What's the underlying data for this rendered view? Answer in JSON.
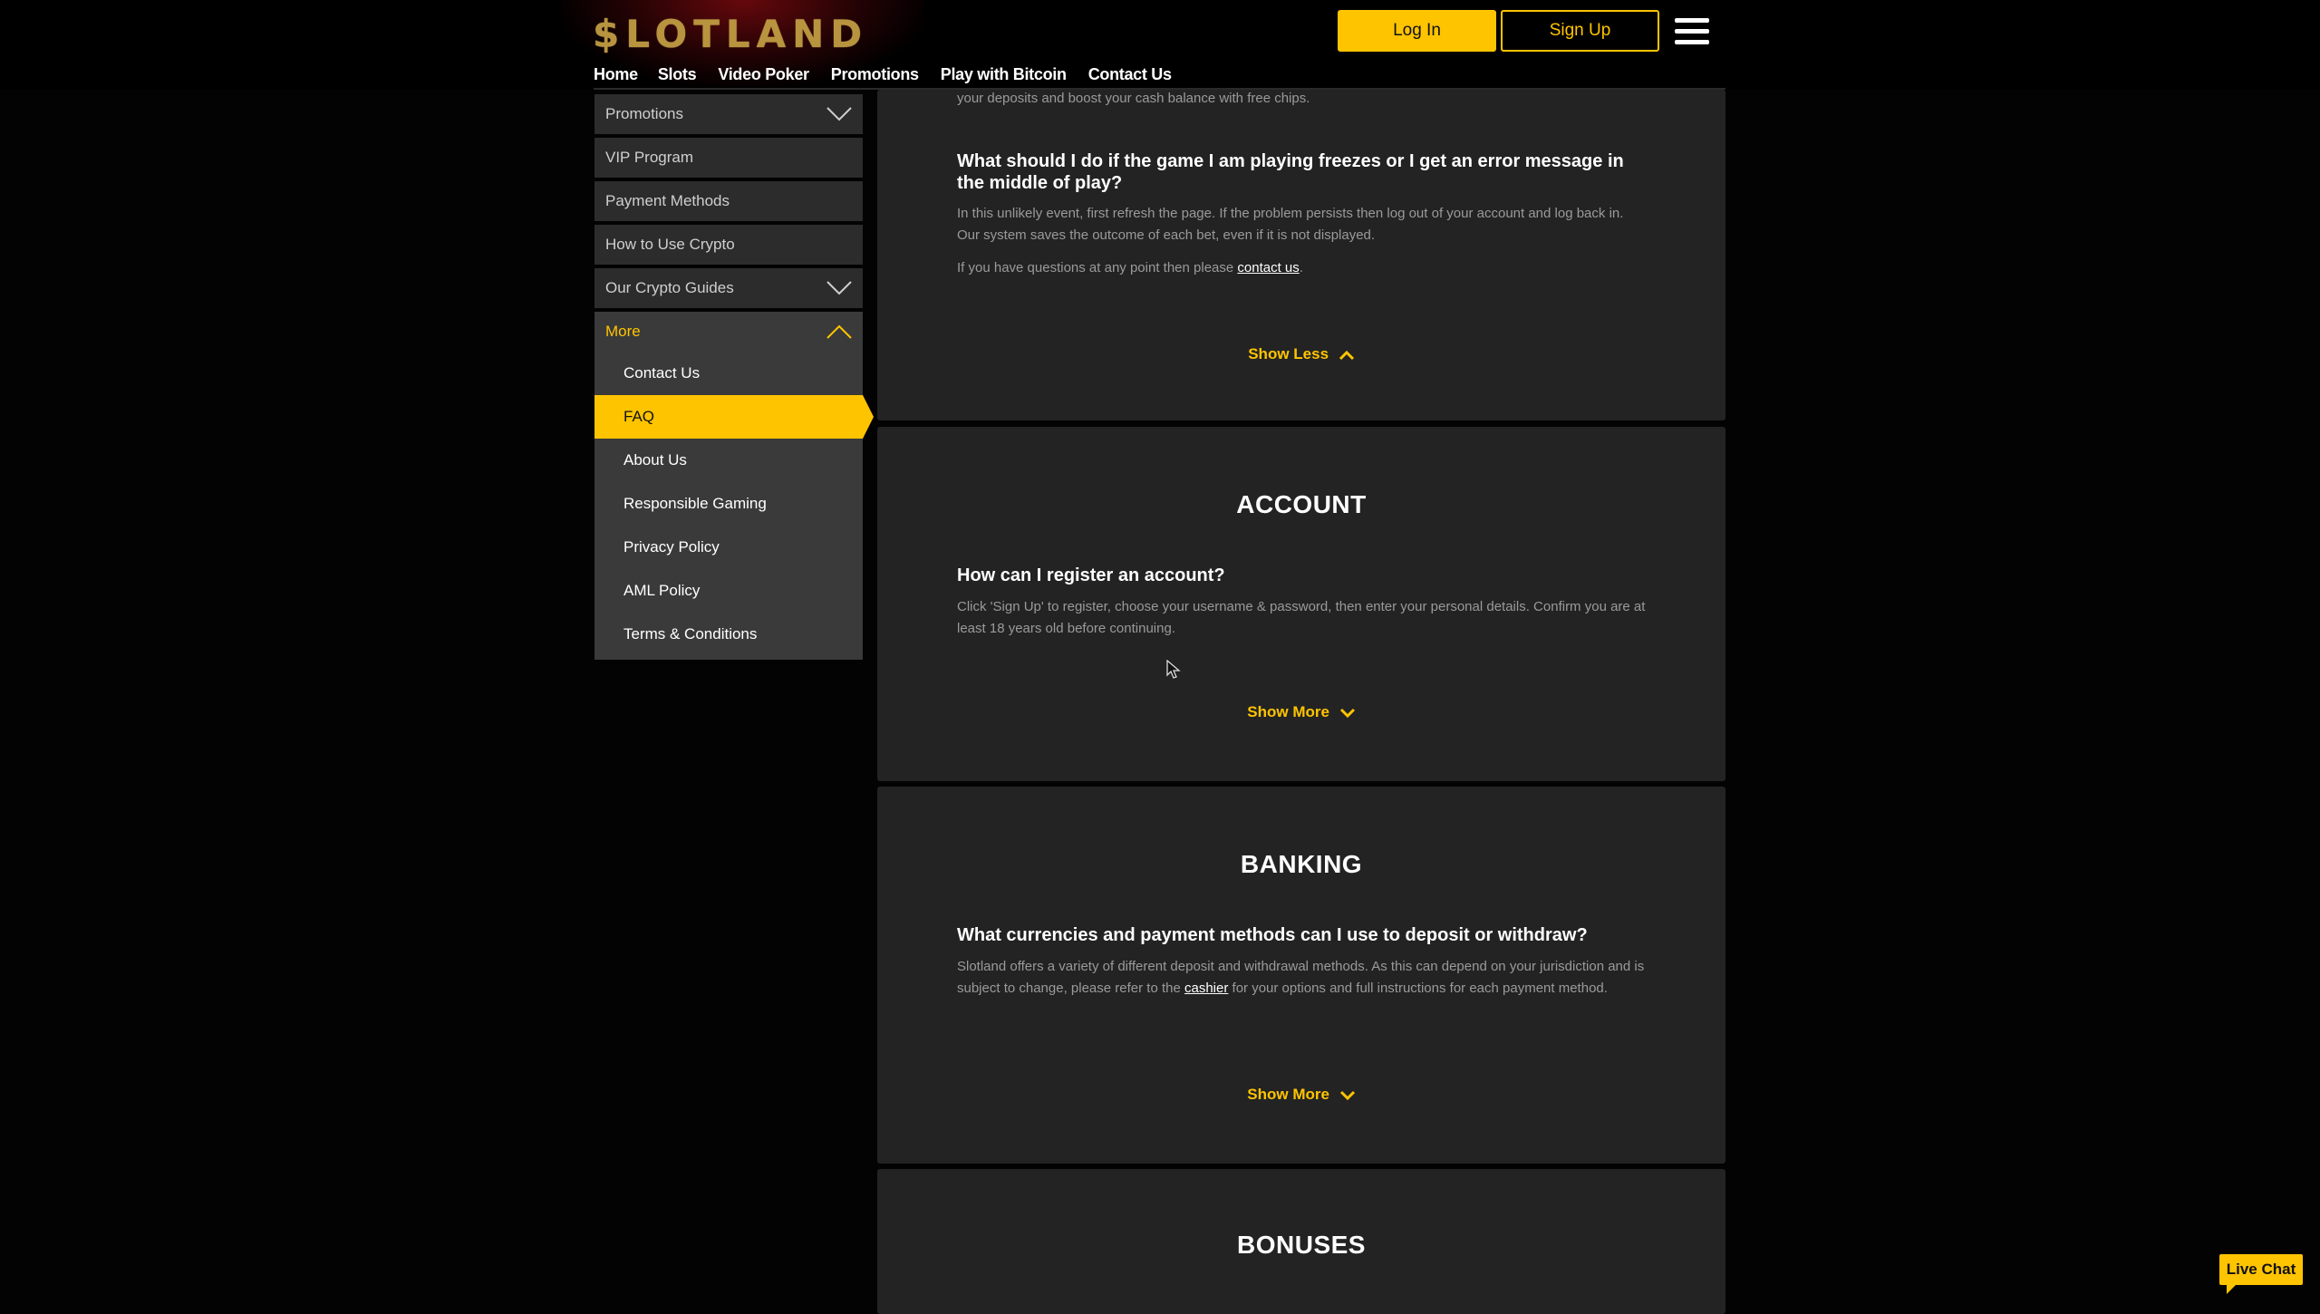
{
  "header": {
    "logo": "$LOTLAND",
    "login_label": "Log In",
    "signup_label": "Sign Up",
    "nav": [
      "Home",
      "Slots",
      "Video Poker",
      "Promotions",
      "Play with Bitcoin",
      "Contact Us"
    ]
  },
  "sidebar": {
    "items": [
      {
        "label": "Promotions",
        "expandable": true
      },
      {
        "label": "VIP Program"
      },
      {
        "label": "Payment Methods"
      },
      {
        "label": "How to Use Crypto"
      },
      {
        "label": "Our Crypto Guides",
        "expandable": true
      }
    ],
    "more": {
      "label": "More",
      "subitems": [
        "Contact Us",
        "FAQ",
        "About Us",
        "Responsible Gaming",
        "Privacy Policy",
        "AML Policy",
        "Terms & Conditions"
      ],
      "active": "FAQ"
    }
  },
  "content": {
    "card1": {
      "cut_text": "your deposits and boost your cash balance with free chips.",
      "question": "What should I do if the game I am playing freezes or I get an error message in the middle of play?",
      "answer_line1": "In this unlikely event, first refresh the page. If the problem persists then log out of your account and log back in.",
      "answer_line2": "Our system saves the outcome of each bet, even if it is not displayed.",
      "contact_prefix": "If you have questions at any point then please ",
      "contact_link": "contact us",
      "contact_suffix": ".",
      "toggle_label": "Show Less"
    },
    "account": {
      "title": "ACCOUNT",
      "question": "How can I register an account?",
      "answer": "Click 'Sign Up' to register, choose your username & password, then enter your personal details. Confirm you are at least 18 years old before continuing.",
      "toggle_label": "Show More"
    },
    "banking": {
      "title": "BANKING",
      "question": "What currencies and payment methods can I use to deposit or withdraw?",
      "answer_prefix": "Slotland offers a variety of different deposit and withdrawal methods. As this can depend on your jurisdiction and is subject to change, please refer to the ",
      "answer_link": "cashier",
      "answer_suffix": " for your options and full instructions for each payment method.",
      "toggle_label": "Show More"
    },
    "bonuses": {
      "title": "BONUSES"
    }
  },
  "livechat": {
    "label": "Live Chat"
  },
  "colors": {
    "accent": "#ffc400",
    "card": "#232323",
    "sidebar": "#2c2c2c",
    "background": "#030303"
  }
}
